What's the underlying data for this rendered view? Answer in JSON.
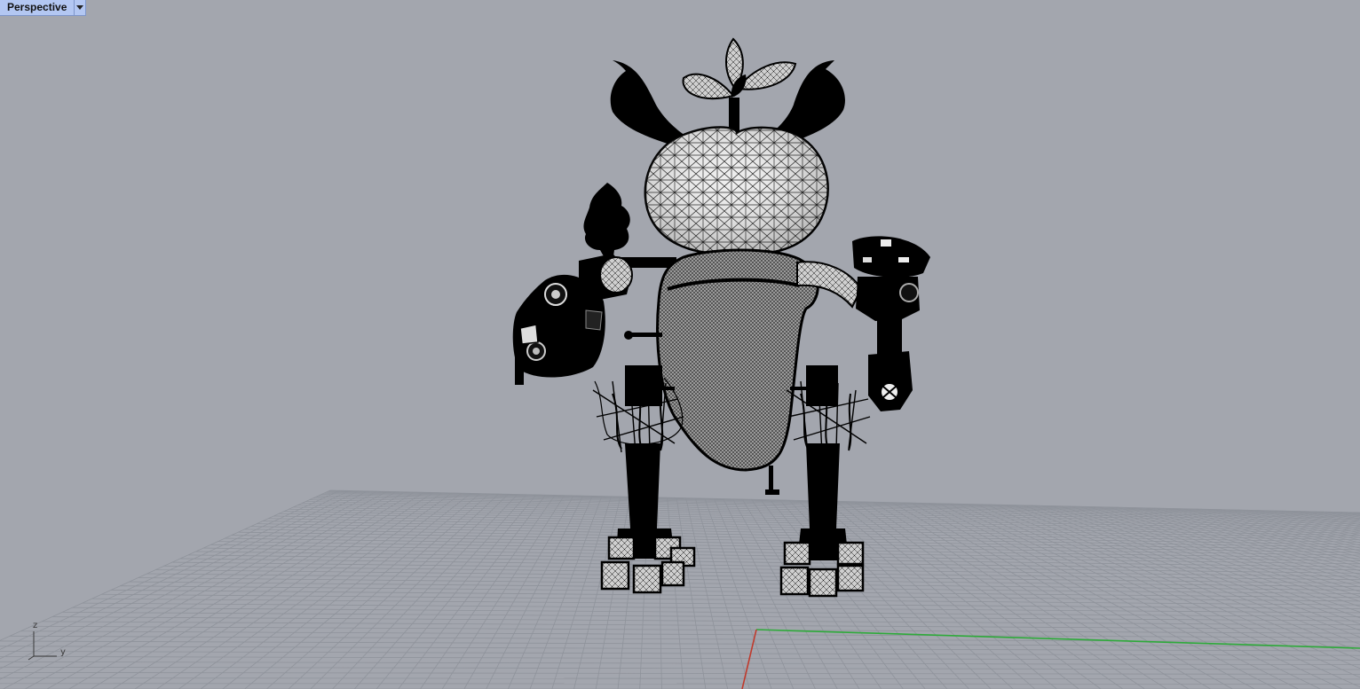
{
  "viewport": {
    "name": "Perspective",
    "display_mode": "wireframe",
    "background_color": "#a3a6ae",
    "grid_color": "#8f939b",
    "x_axis_color": "#c0392b",
    "y_axis_color": "#2eaa3a"
  },
  "world_axes": {
    "z_label": "z",
    "y_label": "y"
  },
  "icons": {
    "viewport_menu": "chevron-down-icon"
  }
}
